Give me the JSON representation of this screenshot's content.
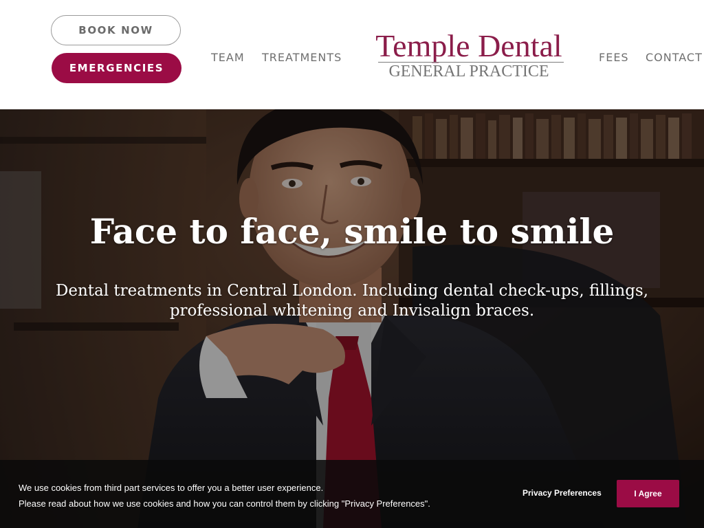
{
  "header": {
    "book_now": "BOOK NOW",
    "emergencies": "EMERGENCIES",
    "nav": {
      "team": "TEAM",
      "treatments": "TREATMENTS",
      "fees": "FEES",
      "contact": "CONTACT"
    },
    "logo": {
      "name": "Temple Dental",
      "subtitle": "GENERAL PRACTICE"
    }
  },
  "hero": {
    "title": "Face to face, smile to smile",
    "subtitle": "Dental treatments in Central London. Including dental check-ups, fillings, professional whitening and Invisalign braces."
  },
  "cookie_banner": {
    "line1": "We use cookies from third part services to offer you a better user experience.",
    "line2": "Please read about how we use cookies and how you can control them by clicking \"Privacy Preferences\".",
    "privacy_preferences": "Privacy Preferences",
    "agree": "I Agree"
  },
  "colors": {
    "brand": "#9b0c45",
    "logo_text": "#8b1d4a",
    "nav_text": "#6f6f6f"
  }
}
